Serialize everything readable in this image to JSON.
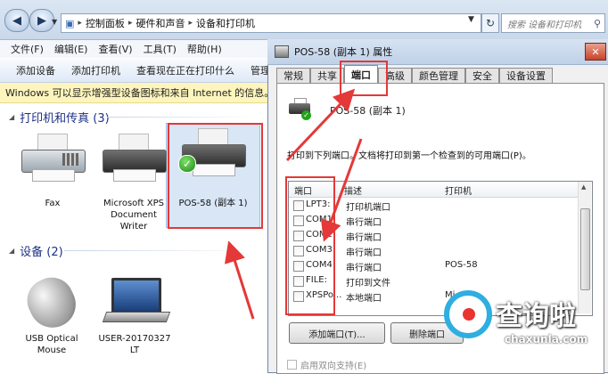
{
  "explorer": {
    "breadcrumb": [
      "控制面板",
      "硬件和声音",
      "设备和打印机"
    ],
    "search_placeholder": "搜索 设备和打印机",
    "menu": [
      "文件(F)",
      "编辑(E)",
      "查看(V)",
      "工具(T)",
      "帮助(H)"
    ],
    "toolbar": [
      "添加设备",
      "添加打印机",
      "查看现在正在打印什么",
      "管理"
    ],
    "infobar": "Windows 可以显示增强型设备图标和来自 Internet 的信息。请单",
    "groups": {
      "printers": "打印机和传真 (3)",
      "devices": "设备 (2)"
    },
    "devices": {
      "fax": "Fax",
      "xps": [
        "Microsoft XPS",
        "Document",
        "Writer"
      ],
      "pos": "POS-58 (副本 1)",
      "mouse": [
        "USB Optical",
        "Mouse"
      ],
      "laptop": [
        "USER-20170327",
        "LT"
      ]
    }
  },
  "dialog": {
    "title": "POS-58 (副本 1) 属性",
    "tabs": [
      "常规",
      "共享",
      "端口",
      "高级",
      "颜色管理",
      "安全",
      "设备设置"
    ],
    "active_tab": "端口",
    "printer_name": "POS-58 (副本 1)",
    "port_description": "打印到下列端口。文档将打印到第一个检查到的可用端口(P)。",
    "columns": [
      "端口",
      "描述",
      "打印机"
    ],
    "ports": [
      {
        "port": "LPT3:",
        "desc": "打印机端口",
        "printer": ""
      },
      {
        "port": "COM1:",
        "desc": "串行端口",
        "printer": ""
      },
      {
        "port": "COM2:",
        "desc": "串行端口",
        "printer": ""
      },
      {
        "port": "COM3:",
        "desc": "串行端口",
        "printer": ""
      },
      {
        "port": "COM4:",
        "desc": "串行端口",
        "printer": "POS-58"
      },
      {
        "port": "FILE:",
        "desc": "打印到文件",
        "printer": ""
      },
      {
        "port": "XPSPo...",
        "desc": "本地端口",
        "printer": "Mi"
      }
    ],
    "add_port": "添加端口(T)...",
    "delete_port": "删除端口",
    "bidirectional": "启用双向支持(E)"
  },
  "watermark": {
    "text": "查询啦",
    "url": "chaxunla.com"
  },
  "colors": {
    "annotation_red": "#e53838",
    "group_header": "#1e3287",
    "watermark_blue": "#2faee0"
  }
}
